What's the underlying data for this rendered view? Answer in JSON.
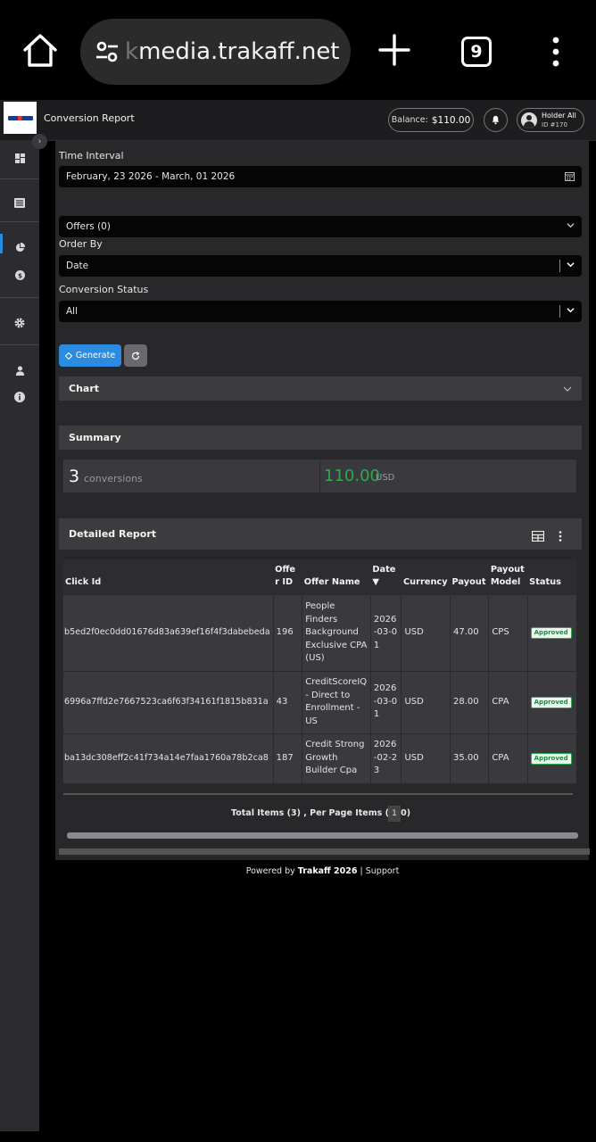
{
  "browser": {
    "url_prefix": "k",
    "url_domain": "media.trakaff.net",
    "tab_count": "9"
  },
  "app": {
    "page_title": "Conversion Report",
    "balance_label": "Balance:",
    "balance_value": "$110.00",
    "user_name": "Holder All",
    "user_id": "ID #170"
  },
  "filters": {
    "time_interval_label": "Time Interval",
    "time_interval_value": "February, 23 2026 - March, 01 2026",
    "offers_value": "Offers (0)",
    "order_by_label": "Order By",
    "order_by_value": "Date",
    "status_label": "Conversion Status",
    "status_value": "All",
    "generate_label": "Generate"
  },
  "chart_panel": {
    "title": "Chart"
  },
  "summary": {
    "title": "Summary",
    "conversions_count": "3",
    "conversions_label": "conversions",
    "amount": "110.00",
    "currency": "USD"
  },
  "report": {
    "title": "Detailed Report",
    "columns": [
      "Click Id",
      "Offe r ID",
      "Offer Name",
      "Date ▼",
      "Currency",
      "Payout",
      "Payout Model",
      "Status"
    ],
    "rows": [
      {
        "click_id": "b5ed2f0ec0dd01676d83a639ef16f4f3dabebeda",
        "offer_id": "196",
        "offer_name": "People Finders Background Exclusive CPA (US)",
        "date": "2026-03-01",
        "currency": "USD",
        "payout": "47.00",
        "model": "CPS",
        "status": "Approved"
      },
      {
        "click_id": "6996a7ffd2e7667523ca6f63f34161f1815b831a",
        "offer_id": "43",
        "offer_name": "CreditScoreIQ - Direct to Enrollment - US",
        "date": "2026-03-01",
        "currency": "USD",
        "payout": "28.00",
        "model": "CPA",
        "status": "Approved"
      },
      {
        "click_id": "ba13dc308eff2c41f734a14e7faa1760a78b2ca8",
        "offer_id": "187",
        "offer_name": "Credit Strong Growth Builder Cpa",
        "date": "2026-02-23",
        "currency": "USD",
        "payout": "35.00",
        "model": "CPA",
        "status": "Approved"
      }
    ],
    "pager_text": "Total Items (3) ,  Per Page Items (100)",
    "current_page": "1"
  },
  "footer": {
    "powered_by": "Powered by ",
    "brand": "Trakaff 2026",
    "separator": " | ",
    "support": "Support"
  },
  "colors": {
    "accent": "#2a8be0",
    "success": "#2fa84f",
    "panel": "#28282b",
    "sidebar": "#2c2c30"
  }
}
